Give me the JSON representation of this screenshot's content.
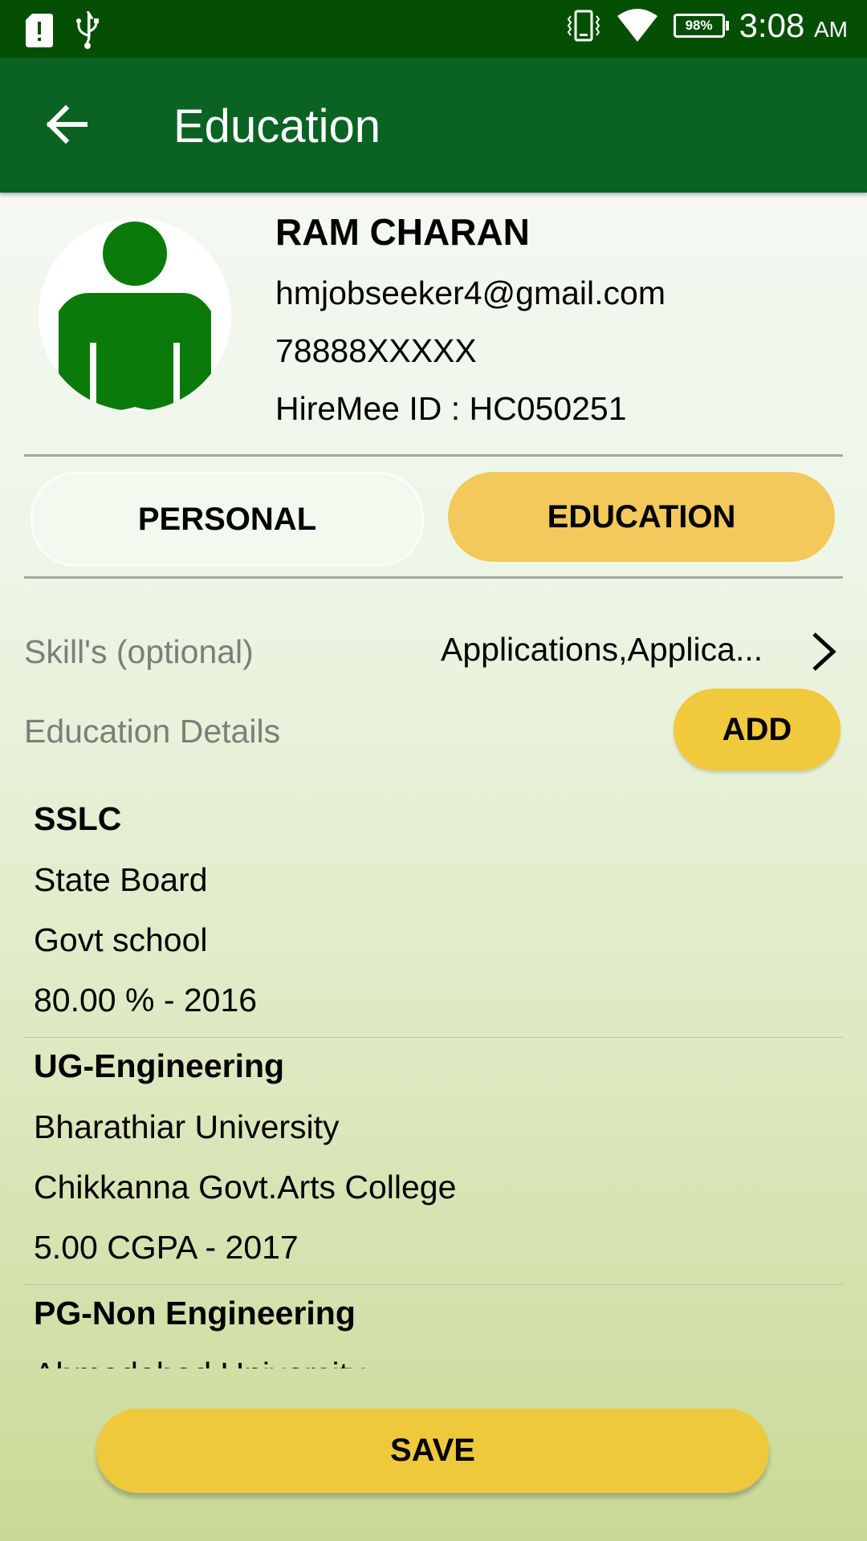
{
  "status_bar": {
    "time": "3:08",
    "am_pm": "AM",
    "battery": "98%",
    "icons": [
      "alert-icon",
      "usb-icon",
      "vibrate-icon",
      "wifi-icon",
      "battery-icon"
    ]
  },
  "app_bar": {
    "title": "Education",
    "back_icon": "arrow-left-icon"
  },
  "profile": {
    "name": "RAM CHARAN",
    "email": "hmjobseeker4@gmail.com",
    "phone": "78888XXXXX",
    "hiremee_id": "HireMee ID : HC050251",
    "avatar_icon": "person-icon"
  },
  "tabs": [
    {
      "label": "PERSONAL",
      "active": false
    },
    {
      "label": "EDUCATION",
      "active": true
    }
  ],
  "skills": {
    "label": "Skill's (optional)",
    "value": "Applications,Applica..."
  },
  "education": {
    "section_label": "Education Details",
    "add_label": "ADD",
    "items": [
      {
        "level": "SSLC",
        "board": "State Board",
        "institution": "Govt school",
        "score": "80.00 % -   2016"
      },
      {
        "level": "UG-Engineering",
        "board": "Bharathiar University",
        "institution": "Chikkanna Govt.Arts College",
        "score": "5.00 CGPA -   2017"
      },
      {
        "level": "PG-Non Engineering",
        "board": "Ahmedabad University",
        "institution": "",
        "score": ""
      }
    ]
  },
  "save_label": "SAVE",
  "colors": {
    "status_bar": "#054f05",
    "app_bar": "#0a6322",
    "accent_yellow": "#f0c93c",
    "avatar_green": "#0a7a0a"
  }
}
